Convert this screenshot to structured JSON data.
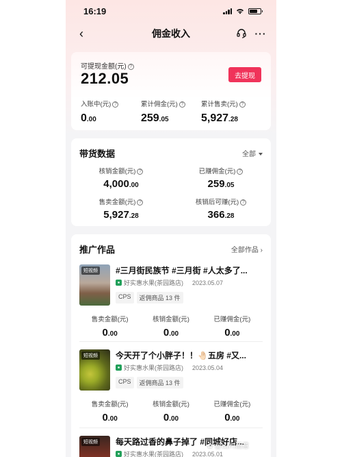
{
  "status": {
    "time": "16:19"
  },
  "nav": {
    "title": "佣金收入",
    "back": "‹",
    "more": "···"
  },
  "balance": {
    "label": "可提现金额(元)",
    "value": "212.05",
    "withdraw_label": "去提现",
    "stats": [
      {
        "label": "入账中(元)",
        "int": "0",
        "dec": ".00"
      },
      {
        "label": "累计佣金(元)",
        "int": "259",
        "dec": ".05"
      },
      {
        "label": "累计售卖(元)",
        "int": "5,927",
        "dec": ".28"
      }
    ]
  },
  "sales": {
    "title": "带货数据",
    "filter": "全部",
    "cells": [
      {
        "label": "核销金额(元)",
        "int": "4,000",
        "dec": ".00"
      },
      {
        "label": "已赚佣金(元)",
        "int": "259",
        "dec": ".05"
      },
      {
        "label": "售卖金额(元)",
        "int": "5,927",
        "dec": ".28"
      },
      {
        "label": "核销后可赚(元)",
        "int": "366",
        "dec": ".28"
      }
    ]
  },
  "works": {
    "title": "推广作品",
    "filter": "全部作品 ›",
    "items": [
      {
        "tag": "短视频",
        "title": "#三月街民族节 #三月街 #人太多了...",
        "shop": "好实惠水果(茶园路店)",
        "date": "2023.05.07",
        "badge": "CPS",
        "goods": "返佣商品 13 件",
        "stats": [
          {
            "label": "售卖金额(元)",
            "int": "0",
            "dec": ".00"
          },
          {
            "label": "核销金额(元)",
            "int": "0",
            "dec": ".00"
          },
          {
            "label": "已赚佣金(元)",
            "int": "0",
            "dec": ".00"
          }
        ]
      },
      {
        "tag": "短视频",
        "title": "今天开了个小胖子！！🤚🏻五房 #又...",
        "shop": "好实惠水果(茶园路店)",
        "date": "2023.05.04",
        "badge": "CPS",
        "goods": "返佣商品 13 件",
        "stats": [
          {
            "label": "售卖金额(元)",
            "int": "0",
            "dec": ".00"
          },
          {
            "label": "核销金额(元)",
            "int": "0",
            "dec": ".00"
          },
          {
            "label": "已赚佣金(元)",
            "int": "0",
            "dec": ".00"
          }
        ]
      },
      {
        "tag": "短视频",
        "title": "每天路过香的鼻子掉了 #同城好店...",
        "shop": "好实惠水果(茶园路店)",
        "date": "2023.05.01"
      }
    ]
  },
  "watermark": "✿ @山川画意",
  "colors": {
    "accent": "#f0335a",
    "shop_icon": "#22a05a"
  }
}
